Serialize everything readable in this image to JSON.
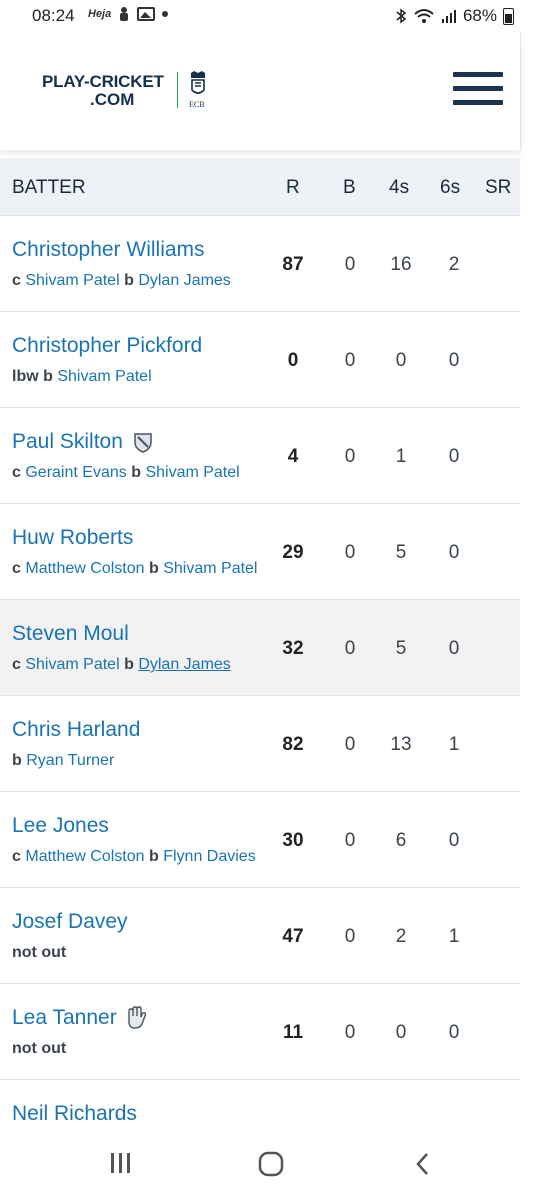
{
  "status_bar": {
    "time": "08:24",
    "notif_app": "Heja",
    "battery": "68%"
  },
  "header": {
    "logo_line1": "PLAY-CRICKET",
    "logo_line2": ".COM",
    "ecb_text": "ECB"
  },
  "table": {
    "headers": {
      "batter": "BATTER",
      "r": "R",
      "b": "B",
      "fours": "4s",
      "sixes": "6s",
      "sr": "SR"
    },
    "rows": [
      {
        "name": "Christopher Williams",
        "dismissal": [
          {
            "t": "c",
            "k": "b"
          },
          {
            "t": "Shivam Patel",
            "k": "l"
          },
          {
            "t": "b",
            "k": "b"
          },
          {
            "t": "Dylan James",
            "k": "l"
          }
        ],
        "r": "87",
        "b": "0",
        "fours": "16",
        "sixes": "2",
        "sr": ""
      },
      {
        "name": "Christopher Pickford",
        "dismissal": [
          {
            "t": "lbw",
            "k": "b"
          },
          {
            "t": "b",
            "k": "b"
          },
          {
            "t": "Shivam Patel",
            "k": "l"
          }
        ],
        "r": "0",
        "b": "0",
        "fours": "0",
        "sixes": "0",
        "sr": ""
      },
      {
        "name": "Paul Skilton",
        "icon": "shield-icon",
        "dismissal": [
          {
            "t": "c",
            "k": "b"
          },
          {
            "t": "Geraint Evans",
            "k": "l"
          },
          {
            "t": "b",
            "k": "b"
          },
          {
            "t": "Shivam Patel",
            "k": "l"
          }
        ],
        "r": "4",
        "b": "0",
        "fours": "1",
        "sixes": "0",
        "sr": ""
      },
      {
        "name": "Huw Roberts",
        "dismissal": [
          {
            "t": "c",
            "k": "b"
          },
          {
            "t": "Matthew Colston",
            "k": "l"
          },
          {
            "t": "b",
            "k": "b"
          },
          {
            "t": "Shivam Patel",
            "k": "l"
          }
        ],
        "r": "29",
        "b": "0",
        "fours": "5",
        "sixes": "0",
        "sr": ""
      },
      {
        "name": "Steven Moul",
        "shaded": true,
        "dismissal": [
          {
            "t": "c",
            "k": "b"
          },
          {
            "t": "Shivam Patel",
            "k": "l"
          },
          {
            "t": "b",
            "k": "b"
          },
          {
            "t": "Dylan James",
            "k": "u"
          }
        ],
        "r": "32",
        "b": "0",
        "fours": "5",
        "sixes": "0",
        "sr": ""
      },
      {
        "name": "Chris Harland",
        "dismissal": [
          {
            "t": "b",
            "k": "b"
          },
          {
            "t": "Ryan Turner",
            "k": "l"
          }
        ],
        "r": "82",
        "b": "0",
        "fours": "13",
        "sixes": "1",
        "sr": ""
      },
      {
        "name": "Lee Jones",
        "dismissal": [
          {
            "t": "c",
            "k": "b"
          },
          {
            "t": "Matthew Colston",
            "k": "l"
          },
          {
            "t": "b",
            "k": "b"
          },
          {
            "t": "Flynn Davies",
            "k": "l"
          }
        ],
        "r": "30",
        "b": "0",
        "fours": "6",
        "sixes": "0",
        "sr": ""
      },
      {
        "name": "Josef Davey",
        "dismissal": [
          {
            "t": "not out",
            "k": "b"
          }
        ],
        "r": "47",
        "b": "0",
        "fours": "2",
        "sixes": "1",
        "sr": ""
      },
      {
        "name": "Lea Tanner",
        "icon": "keeper-glove-icon",
        "dismissal": [
          {
            "t": "not out",
            "k": "b"
          }
        ],
        "r": "11",
        "b": "0",
        "fours": "0",
        "sixes": "0",
        "sr": ""
      },
      {
        "name": "Neil Richards",
        "dismissal": [],
        "r": "",
        "b": "",
        "fours": "",
        "sixes": "",
        "sr": ""
      }
    ]
  },
  "colors": {
    "link": "#1a74b3",
    "navy": "#14304d",
    "green": "#21a04a",
    "header_bg": "#eef1f5"
  },
  "nav": {
    "icons": [
      "recent-apps-icon",
      "home-icon",
      "back-icon"
    ]
  }
}
